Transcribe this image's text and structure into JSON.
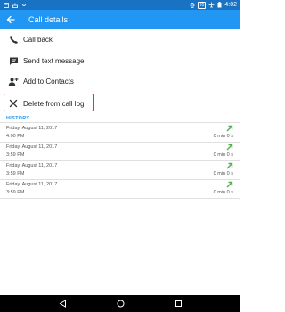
{
  "status_bar": {
    "battery": "95",
    "time": "4:02",
    "icons": [
      "notification-icon",
      "inbox-icon",
      "dropbox-icon",
      "vibrate-icon",
      "airplane-icon",
      "battery-icon"
    ]
  },
  "app_bar": {
    "title": "Call details",
    "back_icon": "arrow-back-icon"
  },
  "actions": [
    {
      "label": "Call back",
      "icon": "phone-icon"
    },
    {
      "label": "Send text message",
      "icon": "message-icon"
    },
    {
      "label": "Add to Contacts",
      "icon": "add-person-icon"
    },
    {
      "label": "Delete from call log",
      "icon": "close-icon",
      "highlight": "#d73a3a"
    }
  ],
  "history": {
    "header": "HISTORY",
    "items": [
      {
        "date": "Friday, August 11, 2017",
        "time": "4:00 PM",
        "duration": "0 min 0 s",
        "direction": "outgoing"
      },
      {
        "date": "Friday, August 11, 2017",
        "time": "3:59 PM",
        "duration": "0 min 0 s",
        "direction": "outgoing"
      },
      {
        "date": "Friday, August 11, 2017",
        "time": "3:59 PM",
        "duration": "0 min 0 s",
        "direction": "outgoing"
      },
      {
        "date": "Friday, August 11, 2017",
        "time": "3:59 PM",
        "duration": "0 min 0 s",
        "direction": "outgoing"
      }
    ]
  },
  "colors": {
    "status_bar": "#1873c5",
    "app_bar": "#2196f3",
    "accent": "#2196f3",
    "outgoing_arrow": "#4caf50",
    "highlight": "#d73a3a"
  },
  "nav_bar": {
    "icons": [
      "back-triangle-icon",
      "home-circle-icon",
      "recents-square-icon"
    ]
  }
}
